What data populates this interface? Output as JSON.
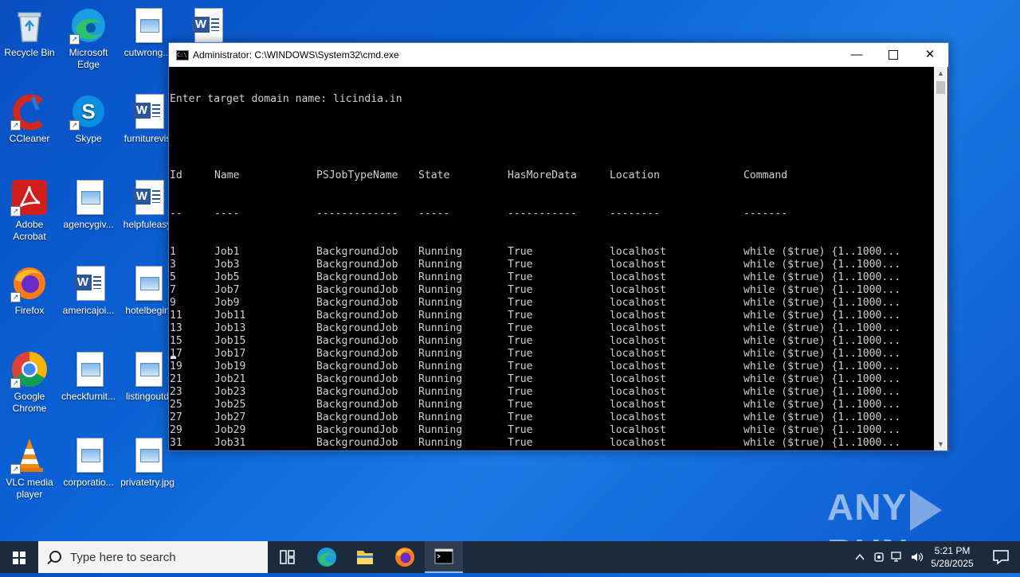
{
  "desktop": {
    "icons": [
      {
        "label": "Recycle Bin"
      },
      {
        "label": "Microsoft Edge"
      },
      {
        "label": "cutwrong..."
      },
      {
        "label": ""
      },
      {
        "label": "CCleaner"
      },
      {
        "label": "Skype"
      },
      {
        "label": "furniturevis"
      },
      {
        "label": "Adobe Acrobat"
      },
      {
        "label": "agencygiv..."
      },
      {
        "label": "helpfuleasy"
      },
      {
        "label": "Firefox"
      },
      {
        "label": "americajoi..."
      },
      {
        "label": "hotelbegin"
      },
      {
        "label": "Google Chrome"
      },
      {
        "label": "checkfurnit..."
      },
      {
        "label": "listingoutd"
      },
      {
        "label": "VLC media player"
      },
      {
        "label": "corporatio..."
      },
      {
        "label": "privatetry.jpg"
      }
    ]
  },
  "cmd": {
    "title": "Administrator: C:\\WINDOWS\\System32\\cmd.exe",
    "app_icon_text": "C:\\",
    "prompt_line": "Enter target domain name: licindia.in",
    "headers": [
      "Id",
      "Name",
      "PSJobTypeName",
      "State",
      "HasMoreData",
      "Location",
      "Command"
    ],
    "separators": [
      "--",
      "----",
      "-------------",
      "-----",
      "-----------",
      "--------",
      "-------"
    ],
    "rows": [
      [
        "1",
        "Job1",
        "BackgroundJob",
        "Running",
        "True",
        "localhost",
        "while ($true) {1..1000..."
      ],
      [
        "3",
        "Job3",
        "BackgroundJob",
        "Running",
        "True",
        "localhost",
        "while ($true) {1..1000..."
      ],
      [
        "5",
        "Job5",
        "BackgroundJob",
        "Running",
        "True",
        "localhost",
        "while ($true) {1..1000..."
      ],
      [
        "7",
        "Job7",
        "BackgroundJob",
        "Running",
        "True",
        "localhost",
        "while ($true) {1..1000..."
      ],
      [
        "9",
        "Job9",
        "BackgroundJob",
        "Running",
        "True",
        "localhost",
        "while ($true) {1..1000..."
      ],
      [
        "11",
        "Job11",
        "BackgroundJob",
        "Running",
        "True",
        "localhost",
        "while ($true) {1..1000..."
      ],
      [
        "13",
        "Job13",
        "BackgroundJob",
        "Running",
        "True",
        "localhost",
        "while ($true) {1..1000..."
      ],
      [
        "15",
        "Job15",
        "BackgroundJob",
        "Running",
        "True",
        "localhost",
        "while ($true) {1..1000..."
      ],
      [
        "17",
        "Job17",
        "BackgroundJob",
        "Running",
        "True",
        "localhost",
        "while ($true) {1..1000..."
      ],
      [
        "19",
        "Job19",
        "BackgroundJob",
        "Running",
        "True",
        "localhost",
        "while ($true) {1..1000..."
      ],
      [
        "21",
        "Job21",
        "BackgroundJob",
        "Running",
        "True",
        "localhost",
        "while ($true) {1..1000..."
      ],
      [
        "23",
        "Job23",
        "BackgroundJob",
        "Running",
        "True",
        "localhost",
        "while ($true) {1..1000..."
      ],
      [
        "25",
        "Job25",
        "BackgroundJob",
        "Running",
        "True",
        "localhost",
        "while ($true) {1..1000..."
      ],
      [
        "27",
        "Job27",
        "BackgroundJob",
        "Running",
        "True",
        "localhost",
        "while ($true) {1..1000..."
      ],
      [
        "29",
        "Job29",
        "BackgroundJob",
        "Running",
        "True",
        "localhost",
        "while ($true) {1..1000..."
      ],
      [
        "31",
        "Job31",
        "BackgroundJob",
        "Running",
        "True",
        "localhost",
        "while ($true) {1..1000..."
      ]
    ]
  },
  "watermark": {
    "left": "ANY",
    "right": "RUN"
  },
  "taskbar": {
    "search_placeholder": "Type here to search",
    "time": "5:21 PM",
    "date": "5/28/2025"
  },
  "colors": {
    "desktop_bg": "#0b63d6",
    "taskbar_bg": "#1b2a3d",
    "console_bg": "#000000",
    "console_fg": "#d0d0d0"
  }
}
